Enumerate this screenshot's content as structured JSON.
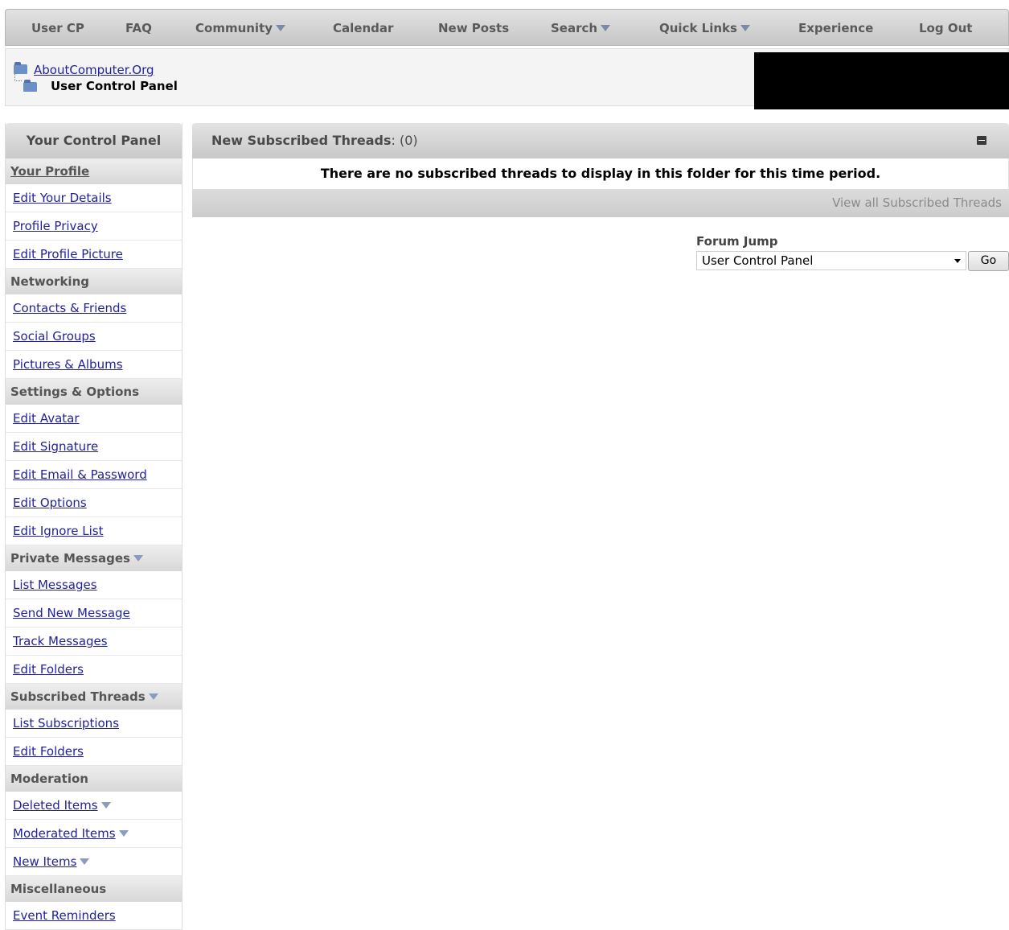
{
  "navbar": {
    "items": [
      {
        "label": "User CP",
        "dropdown": false
      },
      {
        "label": "FAQ",
        "dropdown": false
      },
      {
        "label": "Community",
        "dropdown": true
      },
      {
        "label": "Calendar",
        "dropdown": false
      },
      {
        "label": "New Posts",
        "dropdown": false
      },
      {
        "label": "Search",
        "dropdown": true
      },
      {
        "label": "Quick Links",
        "dropdown": true
      },
      {
        "label": "Experience",
        "dropdown": false
      },
      {
        "label": "Log Out",
        "dropdown": false
      }
    ]
  },
  "breadcrumb": {
    "site": "AboutComputer.Org",
    "current": "User Control Panel"
  },
  "sidebar": {
    "title": "Your Control Panel",
    "sections": [
      {
        "heading": "Your Profile",
        "heading_link": true,
        "dropdown": false,
        "items": [
          {
            "label": "Edit Your Details"
          },
          {
            "label": "Profile Privacy"
          },
          {
            "label": "Edit Profile Picture"
          }
        ]
      },
      {
        "heading": "Networking",
        "heading_link": false,
        "dropdown": false,
        "items": [
          {
            "label": "Contacts & Friends"
          },
          {
            "label": "Social Groups"
          },
          {
            "label": "Pictures & Albums"
          }
        ]
      },
      {
        "heading": "Settings & Options",
        "heading_link": false,
        "dropdown": false,
        "items": [
          {
            "label": "Edit Avatar"
          },
          {
            "label": "Edit Signature"
          },
          {
            "label": "Edit Email & Password"
          },
          {
            "label": "Edit Options"
          },
          {
            "label": "Edit Ignore List"
          }
        ]
      },
      {
        "heading": "Private Messages",
        "heading_link": false,
        "dropdown": true,
        "items": [
          {
            "label": "List Messages"
          },
          {
            "label": "Send New Message"
          },
          {
            "label": "Track Messages"
          },
          {
            "label": "Edit Folders"
          }
        ]
      },
      {
        "heading": "Subscribed Threads",
        "heading_link": false,
        "dropdown": true,
        "items": [
          {
            "label": "List Subscriptions"
          },
          {
            "label": "Edit Folders"
          }
        ]
      },
      {
        "heading": "Moderation",
        "heading_link": false,
        "dropdown": false,
        "items": [
          {
            "label": "Deleted Items",
            "dropdown": true
          },
          {
            "label": "Moderated Items",
            "dropdown": true
          },
          {
            "label": "New Items",
            "dropdown": true
          }
        ]
      },
      {
        "heading": "Miscellaneous",
        "heading_link": false,
        "dropdown": false,
        "items": [
          {
            "label": "Event Reminders"
          }
        ]
      }
    ]
  },
  "main": {
    "title": "New Subscribed Threads",
    "count": ": (0)",
    "empty_message": "There are no subscribed threads to display in this folder for this time period.",
    "view_all": "View all Subscribed Threads"
  },
  "forum_jump": {
    "label": "Forum Jump",
    "selected": "User Control Panel",
    "go_label": "Go"
  }
}
